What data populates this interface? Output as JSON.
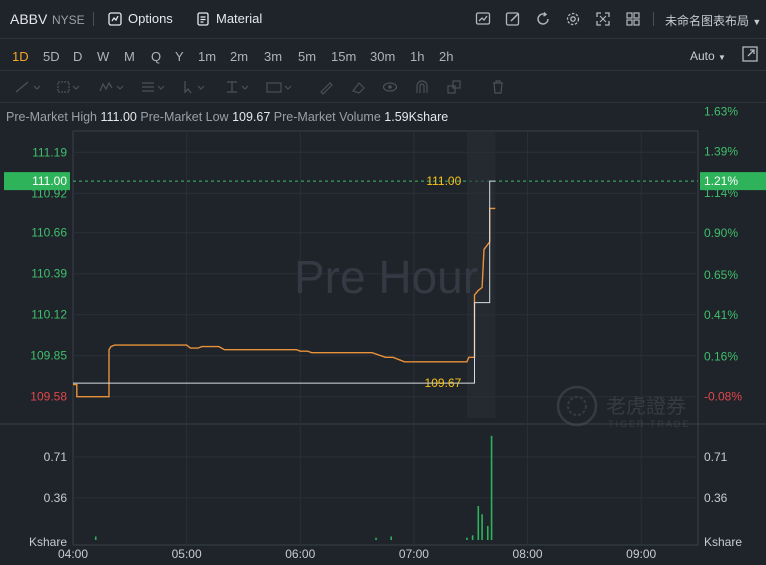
{
  "header": {
    "symbol": "ABBV",
    "exchange": "NYSE",
    "options_label": "Options",
    "material_label": "Material",
    "layout_label": "未命名图表布局",
    "icons": [
      "chart-icon",
      "edit-icon",
      "refresh-icon",
      "settings-icon",
      "fullscreen-icon",
      "grid-icon"
    ]
  },
  "timeframes": {
    "items": [
      "1D",
      "5D",
      "D",
      "W",
      "M",
      "Q",
      "Y",
      "1m",
      "2m",
      "3m",
      "5m",
      "15m",
      "30m",
      "1h",
      "2h"
    ],
    "active": "1D",
    "scale_mode": "Auto"
  },
  "info_bar": {
    "high_label": "Pre-Market High",
    "high_value": "111.00",
    "low_label": "Pre-Market Low",
    "low_value": "109.67",
    "volume_label": "Pre-Market Volume",
    "volume_value": "1.59Kshare"
  },
  "watermark": {
    "session_text": "Pre Hour",
    "brand_cn": "老虎證券",
    "brand_en": "TIGER TRADE"
  },
  "chart_data": {
    "type": "line",
    "title": "",
    "x_ticks": [
      "04:00",
      "05:00",
      "06:00",
      "07:00",
      "08:00",
      "09:00"
    ],
    "x_range_minutes": [
      0,
      330
    ],
    "price_ticks": [
      "111.19",
      "110.92",
      "110.66",
      "110.39",
      "110.12",
      "109.85",
      "109.58"
    ],
    "percent_ticks": [
      "1.63%",
      "1.39%",
      "1.14%",
      "0.90%",
      "0.65%",
      "0.41%",
      "0.16%",
      "-0.08%"
    ],
    "ylim": [
      109.44,
      111.33
    ],
    "prev_close": 109.67,
    "current_price": "111.00",
    "current_percent": "1.21%",
    "high_marker": "111.00",
    "low_marker": "109.67",
    "series": [
      {
        "color": "#e8923a",
        "x_minutes": [
          0,
          2,
          2,
          19,
          19,
          20,
          22,
          60,
          62,
          66,
          68,
          77,
          80,
          118,
          120,
          124,
          126,
          158,
          165,
          169,
          175,
          208,
          209,
          212,
          212,
          214,
          216,
          217,
          220,
          220,
          222,
          223
        ],
        "values": [
          109.66,
          109.66,
          109.58,
          109.58,
          109.89,
          109.91,
          109.92,
          109.92,
          109.9,
          109.9,
          109.91,
          109.91,
          109.89,
          109.89,
          109.88,
          109.88,
          109.87,
          109.87,
          109.84,
          109.84,
          109.81,
          109.81,
          109.84,
          109.84,
          110.25,
          110.28,
          110.3,
          110.55,
          110.6,
          110.82,
          110.82,
          110.82
        ]
      },
      {
        "color": "#d9dde2",
        "x_minutes": [
          0,
          210,
          212,
          212,
          219,
          220,
          220,
          223
        ],
        "values": [
          109.67,
          109.67,
          109.67,
          110.2,
          110.2,
          110.2,
          111.0,
          111.0
        ]
      }
    ],
    "volume": {
      "ylabel": "Kshare",
      "ticks": [
        "0.71",
        "0.36"
      ],
      "ylim": [
        0,
        0.94
      ],
      "x_minutes": [
        12,
        160,
        168,
        208,
        211,
        214,
        216,
        219,
        221
      ],
      "values": [
        0.03,
        0.02,
        0.03,
        0.02,
        0.04,
        0.29,
        0.22,
        0.12,
        0.89
      ]
    }
  }
}
